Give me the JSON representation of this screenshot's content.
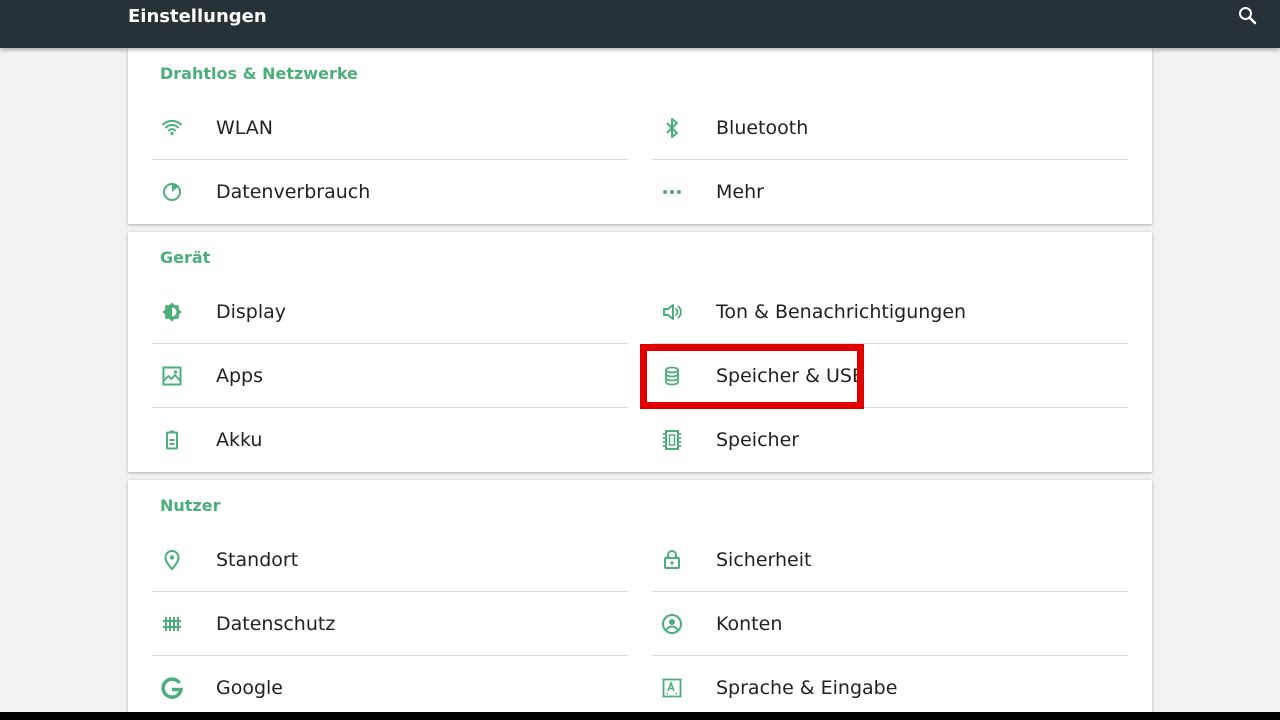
{
  "appbar": {
    "title": "Einstellungen",
    "background": "#263238",
    "search_icon": "search-icon"
  },
  "accent_color": "#4caf7a",
  "highlight_color": "#e00000",
  "sections": [
    {
      "title": "Drahtlos & Netzwerke",
      "items": [
        {
          "label": "WLAN",
          "icon": "wifi-icon"
        },
        {
          "label": "Bluetooth",
          "icon": "bluetooth-icon"
        },
        {
          "label": "Datenverbrauch",
          "icon": "data-usage-icon"
        },
        {
          "label": "Mehr",
          "icon": "more-horiz-icon"
        }
      ]
    },
    {
      "title": "Gerät",
      "items": [
        {
          "label": "Display",
          "icon": "brightness-icon"
        },
        {
          "label": "Ton & Benachrichtigungen",
          "icon": "volume-icon"
        },
        {
          "label": "Apps",
          "icon": "apps-icon"
        },
        {
          "label": "Speicher & USB",
          "icon": "storage-icon"
        },
        {
          "label": "Akku",
          "icon": "battery-icon"
        },
        {
          "label": "Speicher",
          "icon": "memory-icon"
        }
      ]
    },
    {
      "title": "Nutzer",
      "items": [
        {
          "label": "Standort",
          "icon": "location-icon"
        },
        {
          "label": "Sicherheit",
          "icon": "lock-icon"
        },
        {
          "label": "Datenschutz",
          "icon": "privacy-icon"
        },
        {
          "label": "Konten",
          "icon": "account-icon"
        },
        {
          "label": "Google",
          "icon": "google-icon"
        },
        {
          "label": "Sprache & Eingabe",
          "icon": "language-icon"
        }
      ]
    }
  ]
}
